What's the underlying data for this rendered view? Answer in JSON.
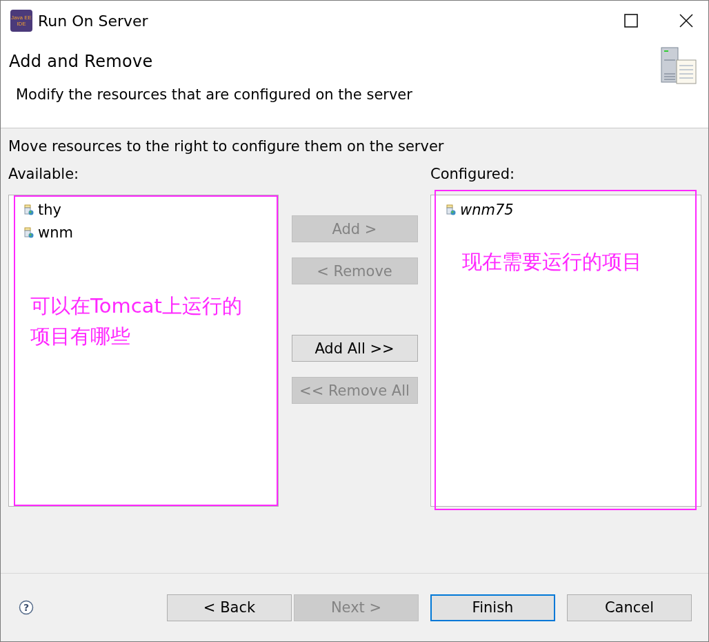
{
  "window": {
    "title": "Run On Server",
    "icon_text": [
      "Java EE",
      "IDE"
    ]
  },
  "header": {
    "title": "Add and Remove",
    "description": "Modify the resources that are configured on the server"
  },
  "instruction": "Move resources to the right to configure them on the server",
  "available": {
    "label": "Available:",
    "items": [
      {
        "name": "thy",
        "pending": false
      },
      {
        "name": "wnm",
        "pending": false
      }
    ],
    "annotation": "可以在Tomcat上运行的项目有哪些"
  },
  "move_buttons": [
    {
      "label": "Add >",
      "disabled": true
    },
    {
      "label": "< Remove",
      "disabled": true
    },
    {
      "label": "Add All >>",
      "disabled": false
    },
    {
      "label": "<< Remove All",
      "disabled": true
    }
  ],
  "configured": {
    "label": "Configured:",
    "items": [
      {
        "name": "wnm75",
        "pending": true
      }
    ],
    "annotation": "现在需要运行的项目"
  },
  "help": "?",
  "footer_buttons": [
    {
      "label": "< Back",
      "disabled": false,
      "default": false
    },
    {
      "label": "Next >",
      "disabled": true,
      "default": false
    },
    {
      "label": "Finish",
      "disabled": false,
      "default": true
    },
    {
      "label": "Cancel",
      "disabled": false,
      "default": false
    }
  ]
}
